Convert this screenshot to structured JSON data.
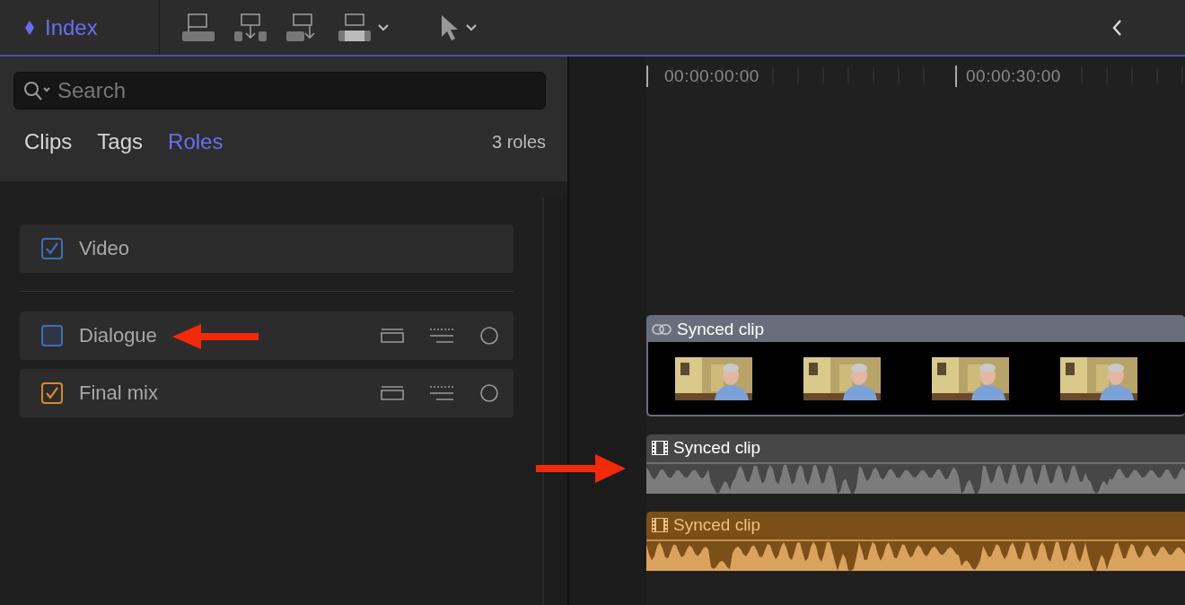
{
  "index_tab": {
    "label": "Index",
    "selected": true
  },
  "search": {
    "placeholder": "Search"
  },
  "tabs": [
    {
      "label": "Clips",
      "selected": false
    },
    {
      "label": "Tags",
      "selected": false
    },
    {
      "label": "Roles",
      "selected": true
    }
  ],
  "count": "3 roles",
  "roles": [
    {
      "kind": "video",
      "name": "Video",
      "checked": true,
      "color": "#3b6fb8"
    },
    {
      "kind": "audio",
      "name": "Dialogue",
      "checked": false,
      "color": "#3b6fb8"
    },
    {
      "kind": "audio",
      "name": "Final mix",
      "checked": true,
      "color": "#d9882a"
    }
  ],
  "ruler": [
    "00:00:00:00",
    "00:00:30:00"
  ],
  "clips": [
    {
      "kind": "video",
      "label": "Synced clip",
      "color": "#686e7c"
    },
    {
      "kind": "audio",
      "label": "Synced clip",
      "color": "#474747"
    },
    {
      "kind": "audio",
      "label": "Synced clip",
      "color": "#7c4f18"
    }
  ]
}
